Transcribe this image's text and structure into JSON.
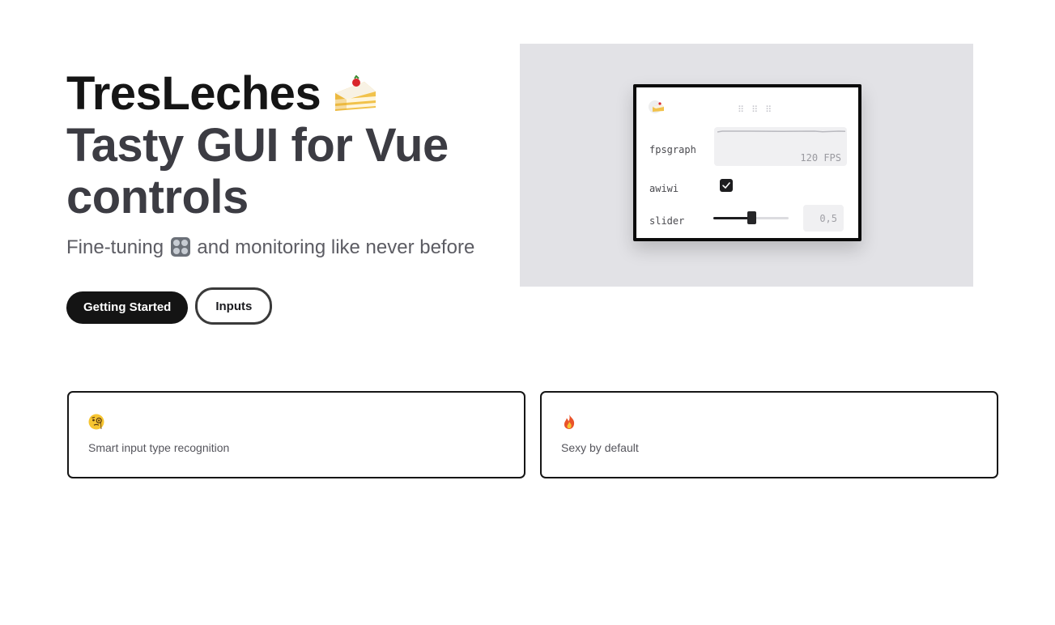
{
  "hero": {
    "title_brand": "TresLeches",
    "title_tagline_1": "Tasty GUI for Vue",
    "title_tagline_2": "controls",
    "subtitle_before": "Fine-tuning",
    "subtitle_after": "and monitoring like never before",
    "brand_icon": "cake-slice-icon",
    "subtitle_icon": "control-knobs-icon"
  },
  "actions": {
    "primary_label": "Getting Started",
    "secondary_label": "Inputs"
  },
  "preview": {
    "fps_label": "fpsgraph",
    "fps_value": "120 FPS",
    "checkbox_label": "awiwi",
    "checkbox_checked": true,
    "slider_label": "slider",
    "slider_value": "0,5",
    "slider_fraction": 0.5
  },
  "features": [
    {
      "icon": "face-with-monocle-icon",
      "text": "Smart input type recognition"
    },
    {
      "icon": "fire-icon",
      "text": "Sexy by default"
    }
  ],
  "colors": {
    "primary_button": "#141414",
    "preview_background": "#e2e2e6"
  }
}
